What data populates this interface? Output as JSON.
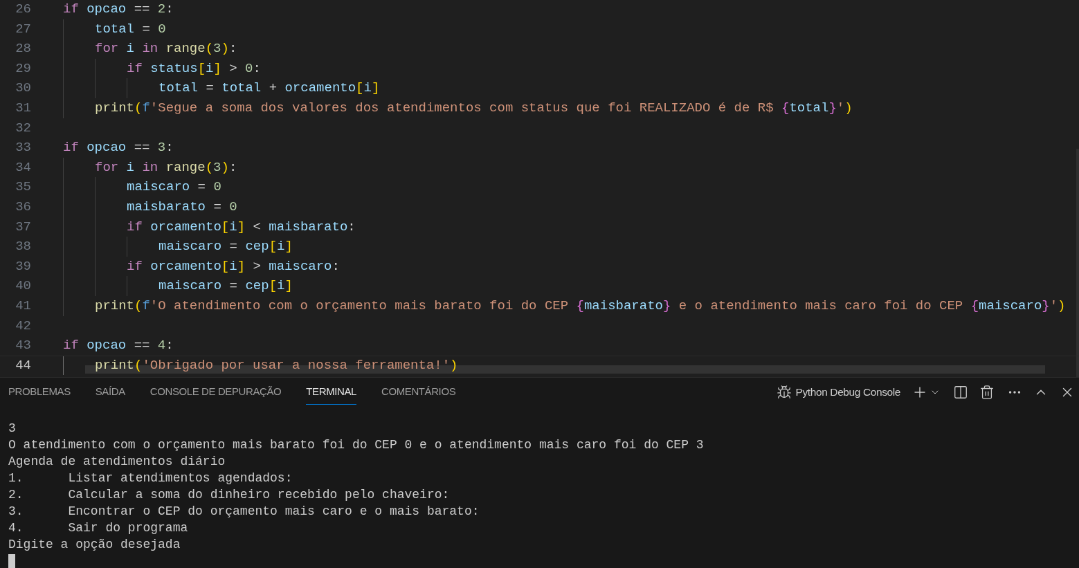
{
  "editor": {
    "lines": [
      {
        "number": "26",
        "current": false,
        "tokens": [
          {
            "t": "if",
            "kind": "keyword"
          },
          {
            "t": " opcao",
            "kind": "variable"
          },
          {
            "t": " == ",
            "kind": "plain"
          },
          {
            "t": "2",
            "kind": "number"
          },
          {
            "t": ":",
            "kind": "plain"
          }
        ],
        "children": [
          {
            "number": "27",
            "current": false,
            "tokens": [
              {
                "t": "total",
                "kind": "variable"
              },
              {
                "t": " = ",
                "kind": "plain"
              },
              {
                "t": "0",
                "kind": "number"
              }
            ]
          },
          {
            "number": "28",
            "current": false,
            "tokens": [
              {
                "t": "for",
                "kind": "keyword"
              },
              {
                "t": " i",
                "kind": "variable"
              },
              {
                "t": " in",
                "kind": "keyword"
              },
              {
                "t": " range",
                "kind": "function"
              },
              {
                "t": "(",
                "kind": "bracket"
              },
              {
                "t": "3",
                "kind": "number"
              },
              {
                "t": ")",
                "kind": "bracket"
              },
              {
                "t": ":",
                "kind": "plain"
              }
            ],
            "children": [
              {
                "number": "29",
                "current": false,
                "tokens": [
                  {
                    "t": "if",
                    "kind": "keyword"
                  },
                  {
                    "t": " status",
                    "kind": "variable"
                  },
                  {
                    "t": "[",
                    "kind": "bracket"
                  },
                  {
                    "t": "i",
                    "kind": "variable"
                  },
                  {
                    "t": "]",
                    "kind": "bracket"
                  },
                  {
                    "t": " > ",
                    "kind": "plain"
                  },
                  {
                    "t": "0",
                    "kind": "number"
                  },
                  {
                    "t": ":",
                    "kind": "plain"
                  }
                ],
                "children": [
                  {
                    "number": "30",
                    "current": false,
                    "tokens": [
                      {
                        "t": "total",
                        "kind": "variable"
                      },
                      {
                        "t": " = ",
                        "kind": "plain"
                      },
                      {
                        "t": "total",
                        "kind": "variable"
                      },
                      {
                        "t": " + ",
                        "kind": "plain"
                      },
                      {
                        "t": "orcamento",
                        "kind": "variable"
                      },
                      {
                        "t": "[",
                        "kind": "bracket"
                      },
                      {
                        "t": "i",
                        "kind": "variable"
                      },
                      {
                        "t": "]",
                        "kind": "bracket"
                      }
                    ]
                  }
                ]
              }
            ]
          },
          {
            "number": "31",
            "current": false,
            "tokens": [
              {
                "t": "print",
                "kind": "function"
              },
              {
                "t": "(",
                "kind": "bracket"
              },
              {
                "t": "f",
                "kind": "prefix"
              },
              {
                "t": "'Segue a soma dos valores dos atendimentos com status que foi REALIZADO é de R$ ",
                "kind": "string"
              },
              {
                "t": "{",
                "kind": "brace"
              },
              {
                "t": "total",
                "kind": "variable"
              },
              {
                "t": "}",
                "kind": "brace"
              },
              {
                "t": "'",
                "kind": "string"
              },
              {
                "t": ")",
                "kind": "bracket"
              }
            ]
          }
        ]
      },
      {
        "number": "32",
        "current": false
      },
      {
        "number": "33",
        "current": false,
        "tokens": [
          {
            "t": "if",
            "kind": "keyword"
          },
          {
            "t": " opcao",
            "kind": "variable"
          },
          {
            "t": " == ",
            "kind": "plain"
          },
          {
            "t": "3",
            "kind": "number"
          },
          {
            "t": ":",
            "kind": "plain"
          }
        ],
        "children": [
          {
            "number": "34",
            "current": false,
            "tokens": [
              {
                "t": "for",
                "kind": "keyword"
              },
              {
                "t": " i",
                "kind": "variable"
              },
              {
                "t": " in",
                "kind": "keyword"
              },
              {
                "t": " range",
                "kind": "function"
              },
              {
                "t": "(",
                "kind": "bracket"
              },
              {
                "t": "3",
                "kind": "number"
              },
              {
                "t": ")",
                "kind": "bracket"
              },
              {
                "t": ":",
                "kind": "plain"
              }
            ],
            "children": [
              {
                "number": "35",
                "current": false,
                "tokens": [
                  {
                    "t": "maiscaro",
                    "kind": "variable"
                  },
                  {
                    "t": " = ",
                    "kind": "plain"
                  },
                  {
                    "t": "0",
                    "kind": "number"
                  }
                ]
              },
              {
                "number": "36",
                "current": false,
                "tokens": [
                  {
                    "t": "maisbarato",
                    "kind": "variable"
                  },
                  {
                    "t": " = ",
                    "kind": "plain"
                  },
                  {
                    "t": "0",
                    "kind": "number"
                  }
                ]
              },
              {
                "number": "37",
                "current": false,
                "tokens": [
                  {
                    "t": "if",
                    "kind": "keyword"
                  },
                  {
                    "t": " orcamento",
                    "kind": "variable"
                  },
                  {
                    "t": "[",
                    "kind": "bracket"
                  },
                  {
                    "t": "i",
                    "kind": "variable"
                  },
                  {
                    "t": "]",
                    "kind": "bracket"
                  },
                  {
                    "t": " < ",
                    "kind": "plain"
                  },
                  {
                    "t": "maisbarato",
                    "kind": "variable"
                  },
                  {
                    "t": ":",
                    "kind": "plain"
                  }
                ],
                "children": [
                  {
                    "number": "38",
                    "current": false,
                    "tokens": [
                      {
                        "t": "maiscaro",
                        "kind": "variable"
                      },
                      {
                        "t": " = ",
                        "kind": "plain"
                      },
                      {
                        "t": "cep",
                        "kind": "variable"
                      },
                      {
                        "t": "[",
                        "kind": "bracket"
                      },
                      {
                        "t": "i",
                        "kind": "variable"
                      },
                      {
                        "t": "]",
                        "kind": "bracket"
                      }
                    ]
                  }
                ]
              },
              {
                "number": "39",
                "current": false,
                "tokens": [
                  {
                    "t": "if",
                    "kind": "keyword"
                  },
                  {
                    "t": " orcamento",
                    "kind": "variable"
                  },
                  {
                    "t": "[",
                    "kind": "bracket"
                  },
                  {
                    "t": "i",
                    "kind": "variable"
                  },
                  {
                    "t": "]",
                    "kind": "bracket"
                  },
                  {
                    "t": " > ",
                    "kind": "plain"
                  },
                  {
                    "t": "maiscaro",
                    "kind": "variable"
                  },
                  {
                    "t": ":",
                    "kind": "plain"
                  }
                ],
                "children": [
                  {
                    "number": "40",
                    "current": false,
                    "tokens": [
                      {
                        "t": "maiscaro",
                        "kind": "variable"
                      },
                      {
                        "t": " = ",
                        "kind": "plain"
                      },
                      {
                        "t": "cep",
                        "kind": "variable"
                      },
                      {
                        "t": "[",
                        "kind": "bracket"
                      },
                      {
                        "t": "i",
                        "kind": "variable"
                      },
                      {
                        "t": "]",
                        "kind": "bracket"
                      }
                    ]
                  }
                ]
              }
            ]
          },
          {
            "number": "41",
            "current": false,
            "tokens": [
              {
                "t": "print",
                "kind": "function"
              },
              {
                "t": "(",
                "kind": "bracket"
              },
              {
                "t": "f",
                "kind": "prefix"
              },
              {
                "t": "'O atendimento com o orçamento mais barato foi do CEP ",
                "kind": "string"
              },
              {
                "t": "{",
                "kind": "brace"
              },
              {
                "t": "maisbarato",
                "kind": "variable"
              },
              {
                "t": "}",
                "kind": "brace"
              },
              {
                "t": " e o atendimento mais caro foi do CEP ",
                "kind": "string"
              },
              {
                "t": "{",
                "kind": "brace"
              },
              {
                "t": "maiscaro",
                "kind": "variable"
              },
              {
                "t": "}",
                "kind": "brace"
              },
              {
                "t": "'",
                "kind": "string"
              },
              {
                "t": ")",
                "kind": "bracket"
              }
            ]
          }
        ]
      },
      {
        "number": "42",
        "current": false
      },
      {
        "number": "43",
        "current": false,
        "tokens": [
          {
            "t": "if",
            "kind": "keyword"
          },
          {
            "t": " opcao",
            "kind": "variable"
          },
          {
            "t": " == ",
            "kind": "plain"
          },
          {
            "t": "4",
            "kind": "number"
          },
          {
            "t": ":",
            "kind": "plain"
          }
        ],
        "children": [
          {
            "number": "44",
            "current": true,
            "tokens": [
              {
                "t": "print",
                "kind": "function"
              },
              {
                "t": "(",
                "kind": "bracket"
              },
              {
                "t": "'Obrigado por usar a nossa ferramenta!'",
                "kind": "string"
              },
              {
                "t": ")",
                "kind": "bracket"
              }
            ]
          }
        ]
      }
    ]
  },
  "panel": {
    "tabs": [
      {
        "label": "PROBLEMAS",
        "selected": false
      },
      {
        "label": "SAÍDA",
        "selected": false
      },
      {
        "label": "CONSOLE DE DEPURAÇÃO",
        "selected": false
      },
      {
        "label": "TERMINAL",
        "selected": true
      },
      {
        "label": "COMENTÁRIOS",
        "selected": false
      }
    ],
    "terminal_name": "Python Debug Console",
    "terminal_lines": [
      "3",
      "O atendimento com o orçamento mais barato foi do CEP 0 e o atendimento mais caro foi do CEP 3",
      "Agenda de atendimentos diário",
      "1.\tListar atendimentos agendados:",
      "2.\tCalcular a soma do dinheiro recebido pelo chaveiro:",
      "3.\tEncontrar o CEP do orçamento mais caro e o mais barato:",
      "4.\tSair do programa",
      "Digite a opção desejada"
    ]
  }
}
